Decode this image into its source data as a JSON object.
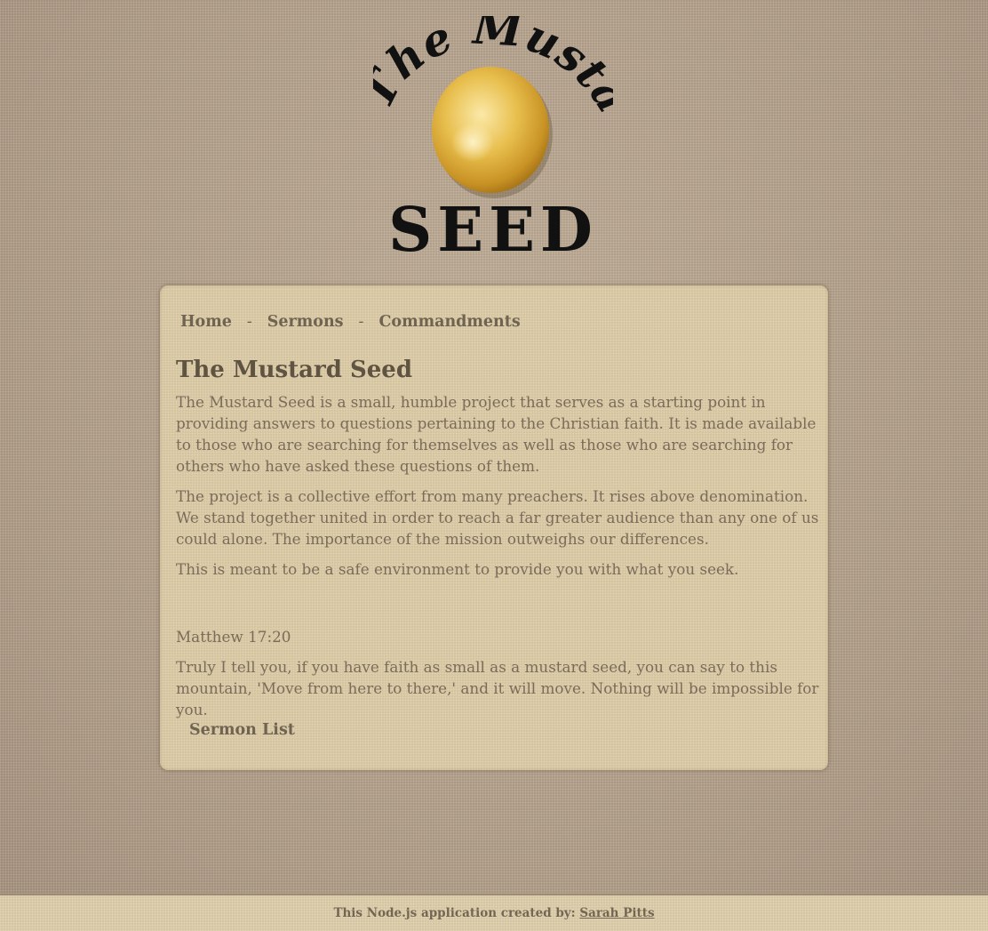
{
  "logo": {
    "top_text": "The Mustard",
    "bottom_text": "SEED",
    "icon": "mustard-seed-icon"
  },
  "nav": {
    "items": [
      {
        "label": "Home"
      },
      {
        "label": "Sermons"
      },
      {
        "label": "Commandments"
      }
    ],
    "separator": "-"
  },
  "main": {
    "title": "The Mustard Seed",
    "paragraphs": [
      "The Mustard Seed is a small, humble project that serves as a starting point in providing answers to questions pertaining to the Christian faith. It is made available to those who are searching for themselves as well as those who are searching for others who have asked these questions of them.",
      "The project is a collective effort from many preachers. It rises above denomination. We stand together united in order to reach a far greater audience than any one of us could alone. The importance of the mission outweighs our differences.",
      "This is meant to be a safe environment to provide you with what you seek."
    ],
    "verse_reference": "Matthew 17:20",
    "verse_text": "Truly I tell you, if you have faith as small as a mustard seed, you can say to this mountain, 'Move from here to there,' and it will move. Nothing will be impossible for you.",
    "sermon_list_link": "Sermon List"
  },
  "footer": {
    "credit_text": "This Node.js application created by:",
    "author": "Sarah Pitts"
  },
  "colors": {
    "background": "#b7a48e",
    "panel": "#ddcca6",
    "text": "#7a6c5a",
    "heading": "#5f5342",
    "seed": "#e2b33e"
  }
}
